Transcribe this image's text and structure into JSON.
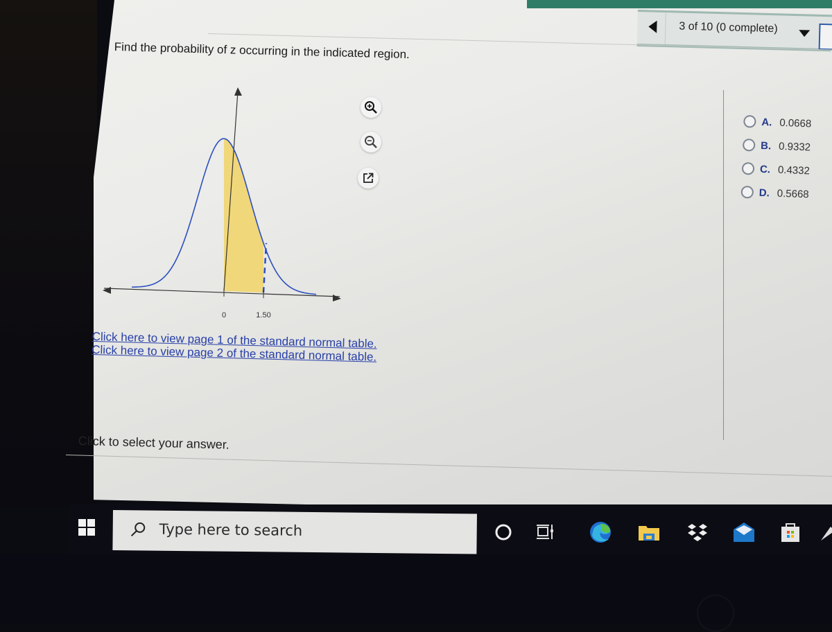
{
  "navigation": {
    "progress_text": "3 of 10 (0 complete)",
    "prev_icon": "triangle-left-icon",
    "dropdown_icon": "triangle-down-icon"
  },
  "question": {
    "prompt": "Find the probability of z occurring in the indicated region.",
    "graph_tools": [
      "zoom-in-icon",
      "zoom-out-icon",
      "external-link-icon"
    ],
    "links": [
      "Click here to view page 1 of the standard normal table.",
      "Click here to view page 2 of the standard normal table."
    ],
    "hint": "Click to select your answer."
  },
  "answers": [
    {
      "letter": "A.",
      "value": "0.0668"
    },
    {
      "letter": "B.",
      "value": "0.9332"
    },
    {
      "letter": "C.",
      "value": "0.4332"
    },
    {
      "letter": "D.",
      "value": "0.5668"
    }
  ],
  "chart_data": {
    "type": "area",
    "title": "",
    "distribution": "standard normal",
    "shaded_region": {
      "from": 0,
      "to": 1.5
    },
    "tick_labels": [
      "0",
      "1.50"
    ],
    "x_ticks": [
      0,
      1.5
    ],
    "xlim": [
      -3.5,
      3.5
    ],
    "curve_color": "#2b4fbf",
    "fill_color": "#f0d77a"
  },
  "taskbar": {
    "search_placeholder": "Type here to search",
    "icons": [
      "windows-start-icon",
      "search-icon",
      "cortana-icon",
      "task-view-icon",
      "edge-icon",
      "file-explorer-icon",
      "dropbox-icon",
      "mail-icon",
      "store-icon"
    ]
  },
  "colors": {
    "link": "#2840a8",
    "answer_letter": "#233a8a",
    "top_band": "#2f7d66"
  }
}
